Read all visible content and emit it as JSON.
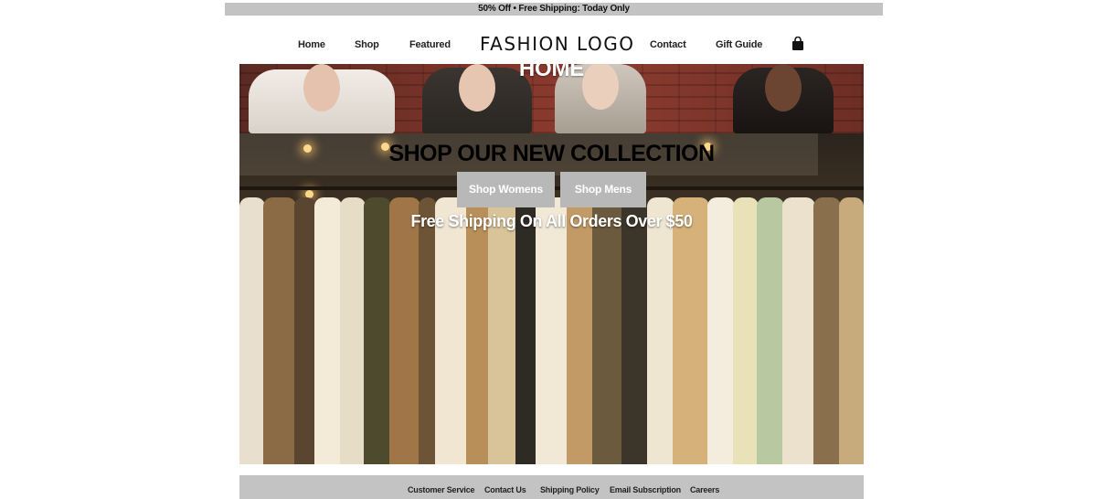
{
  "promo": {
    "text": "50% Off • Free Shipping: Today Only"
  },
  "nav": {
    "home": "Home",
    "shop": "Shop",
    "featured": "Featured",
    "logo": "FASHION LOGO",
    "contact": "Contact",
    "gift_guide": "Gift Guide"
  },
  "hero": {
    "page_title": "HOME",
    "heading": "SHOP OUR NEW COLLECTION",
    "shop_womens": "Shop Womens",
    "shop_mens": "Shop Mens",
    "shipping_note": "Free Shipping On All Orders Over $50"
  },
  "footer": {
    "links": [
      "Customer Service",
      "Contact Us",
      "Shipping Policy",
      "Email Subscription",
      "Careers"
    ]
  },
  "colors": {
    "bar_gray": "#c3c3c3",
    "button_gray": "#b8b8b8",
    "brick": "#7a3328"
  },
  "icons": {
    "cart": "shopping-bag-icon"
  }
}
